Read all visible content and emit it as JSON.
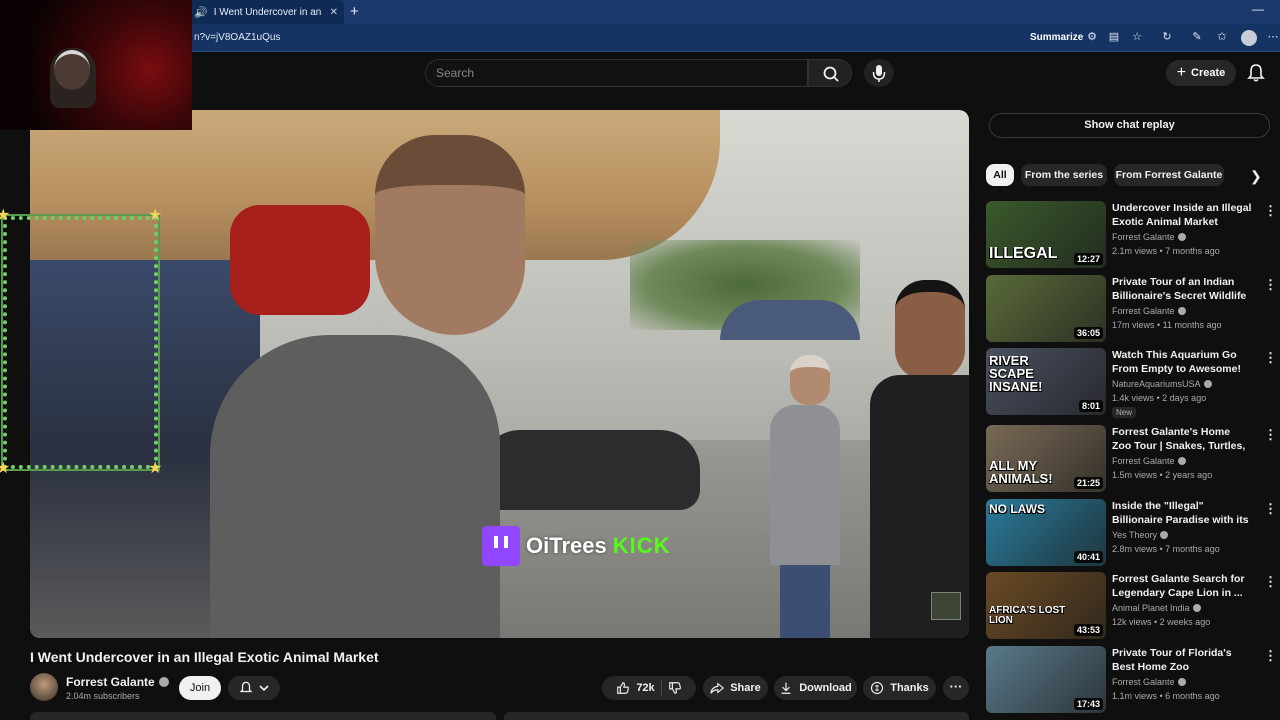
{
  "browser": {
    "tab_title": "I Went Undercover in an Illegal",
    "tab_close": "✕",
    "new_tab": "+",
    "minimize": "—",
    "url": "n?v=jV8OAZ1uQus",
    "summarize_label": "Summarize"
  },
  "header": {
    "search_placeholder": "Search",
    "create_label": "Create"
  },
  "video": {
    "watermark_text": "OiTrees",
    "watermark_kick": "KICK",
    "title": "I Went Undercover in an Illegal Exotic Animal Market"
  },
  "channel": {
    "name": "Forrest Galante",
    "subscribers": "2.04m subscribers",
    "join_label": "Join"
  },
  "actions": {
    "likes": "72k",
    "share_label": "Share",
    "download_label": "Download",
    "thanks_label": "Thanks",
    "more_label": "···"
  },
  "sidebar": {
    "chat_replay_label": "Show chat replay",
    "chips": [
      "All",
      "From the series",
      "From Forrest Galante"
    ],
    "recommendations": [
      {
        "title": "Undercover Inside an Illegal Exotic Animal Market",
        "channel": "Forrest Galante",
        "meta": "2.1m views • 7 months ago",
        "duration": "12:27",
        "thumb_text": "ILLEGAL",
        "thumb_color": "#3a5a2c"
      },
      {
        "title": "Private Tour of an Indian Billionaire's Secret Wildlife ...",
        "channel": "Forrest Galante",
        "meta": "17m views • 11 months ago",
        "duration": "36:05",
        "thumb_text": "",
        "thumb_color": "#5a6a3a"
      },
      {
        "title": "Watch This Aquarium Go From Empty to Awesome!",
        "channel": "NatureAquariumsUSA",
        "meta": "1.4k views • 2 days ago",
        "duration": "8:01",
        "thumb_text": "RIVER SCAPE INSANE!",
        "thumb_color": "#4a5060",
        "badge": "New"
      },
      {
        "title": "Forrest Galante's Home Zoo Tour | Snakes, Turtles, Mini ...",
        "channel": "Forrest Galante",
        "meta": "1.5m views • 2 years ago",
        "duration": "21:25",
        "thumb_text": "ALL MY ANIMALS!",
        "thumb_color": "#7a6a56"
      },
      {
        "title": "Inside the \"Illegal\" Billionaire Paradise with its Own Laws",
        "channel": "Yes Theory",
        "meta": "2.8m views • 7 months ago",
        "duration": "40:41",
        "thumb_text": "NO LAWS",
        "thumb_color": "#2a7a9a"
      },
      {
        "title": "Forrest Galante Search for Legendary Cape Lion in ...",
        "channel": "Animal Planet India",
        "meta": "12k views • 2 weeks ago",
        "duration": "43:53",
        "thumb_text": "AFRICA'S LOST LION",
        "thumb_color": "#6a4a24"
      },
      {
        "title": "Private Tour of Florida's Best Home Zoo",
        "channel": "Forrest Galante",
        "meta": "1.1m views • 6 months ago",
        "duration": "17:43",
        "thumb_text": "",
        "thumb_color": "#5a7a8a"
      }
    ]
  }
}
